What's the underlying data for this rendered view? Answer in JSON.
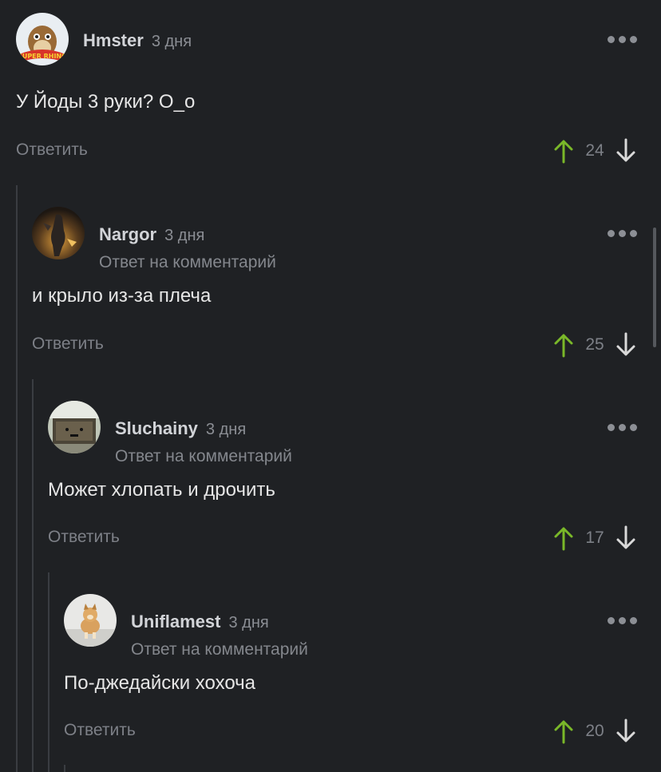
{
  "comments": [
    {
      "user": "Hmster",
      "time": "3 дня",
      "reply_note": "",
      "text": "У Йоды 3 руки? О_о",
      "reply_label": "Ответить",
      "rating": "24",
      "avatar_text": "SUPER RHINO"
    },
    {
      "user": "Nargor",
      "time": "3 дня",
      "reply_note": "Ответ на комментарий",
      "text": "и крыло из-за плеча",
      "reply_label": "Ответить",
      "rating": "25"
    },
    {
      "user": "Sluchainy",
      "time": "3 дня",
      "reply_note": "Ответ на комментарий",
      "text": "Может хлопать и дрочить",
      "reply_label": "Ответить",
      "rating": "17"
    },
    {
      "user": "Uniflamest",
      "time": "3 дня",
      "reply_note": "Ответ на комментарий",
      "text": "По-джедайски хохоча",
      "reply_label": "Ответить",
      "rating": "20"
    }
  ],
  "colors": {
    "background": "#1f2124",
    "upvote": "#7ab829",
    "downvote": "#d9d9d9",
    "muted": "#7d8087"
  }
}
